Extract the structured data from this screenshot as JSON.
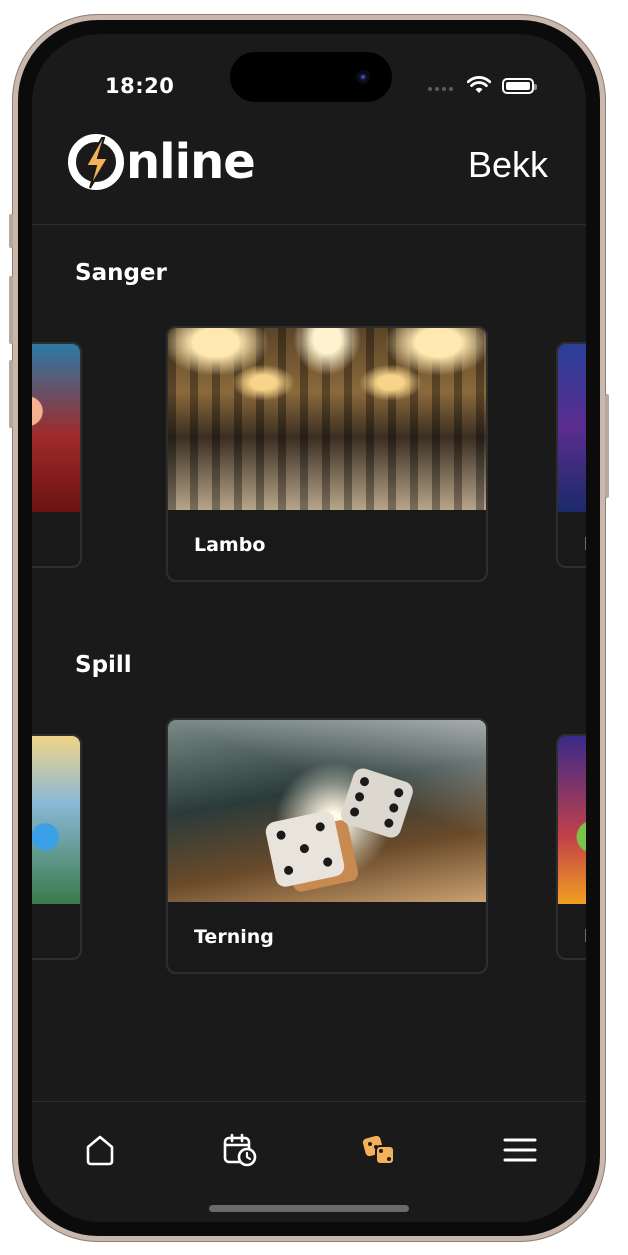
{
  "status_bar": {
    "time": "18:20"
  },
  "header": {
    "logo_text": "nline",
    "logo_letter": "O",
    "right_label": "Bekk"
  },
  "sections": [
    {
      "title": "Sanger",
      "items": [
        {
          "label": "",
          "art": "party"
        },
        {
          "label": "Lambo",
          "art": "ballroom"
        },
        {
          "label": "Nu",
          "art": "music"
        }
      ]
    },
    {
      "title": "Spill",
      "items": [
        {
          "label": "",
          "art": "school"
        },
        {
          "label": "Terning",
          "art": "dice"
        },
        {
          "label": "Hu",
          "art": "cartoon"
        }
      ]
    }
  ],
  "tab_bar": {
    "items": [
      {
        "icon": "home-icon",
        "active": false
      },
      {
        "icon": "calendar-clock-icon",
        "active": false
      },
      {
        "icon": "dice-icon",
        "active": true
      },
      {
        "icon": "menu-icon",
        "active": false
      }
    ],
    "active_color": "#f3b15b",
    "inactive_color": "#ffffff"
  }
}
